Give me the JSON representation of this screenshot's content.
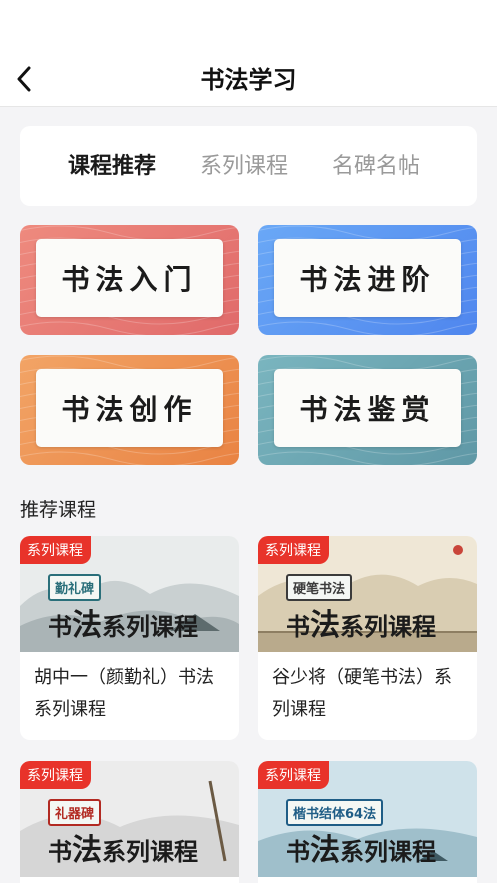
{
  "header": {
    "title": "书法学习",
    "back_icon": "chevron-left-icon"
  },
  "tabs": [
    {
      "label": "课程推荐",
      "active": true
    },
    {
      "label": "系列课程",
      "active": false
    },
    {
      "label": "名碑名帖",
      "active": false
    }
  ],
  "colors": {
    "accent": "#f08a24",
    "badge": "#e8332a"
  },
  "categories": [
    {
      "label": "书法入门",
      "gradient": [
        "#ee8a7e",
        "#e06a6a"
      ]
    },
    {
      "label": "书法进阶",
      "gradient": [
        "#6aa8f6",
        "#4f86ee"
      ]
    },
    {
      "label": "书法创作",
      "gradient": [
        "#f2a466",
        "#e98343"
      ]
    },
    {
      "label": "书法鉴赏",
      "gradient": [
        "#7ab5bf",
        "#5f98a6"
      ]
    }
  ],
  "section": {
    "title": "推荐课程"
  },
  "courses": [
    {
      "badge": "系列课程",
      "tag": "勤礼碑",
      "headline_a": "书",
      "headline_b": "法",
      "headline_c": "系列课程",
      "name": "胡中一（颜勤礼）书法系列课程"
    },
    {
      "badge": "系列课程",
      "tag": "硬笔书法",
      "headline_a": "书",
      "headline_b": "法",
      "headline_c": "系列课程",
      "name": "谷少将（硬笔书法）系列课程"
    },
    {
      "badge": "系列课程",
      "tag": "礼器碑",
      "headline_a": "书",
      "headline_b": "法",
      "headline_c": "系列课程",
      "name": ""
    },
    {
      "badge": "系列课程",
      "tag": "楷书结体64法",
      "headline_a": "书",
      "headline_b": "法",
      "headline_c": "系列课程",
      "name": ""
    }
  ]
}
